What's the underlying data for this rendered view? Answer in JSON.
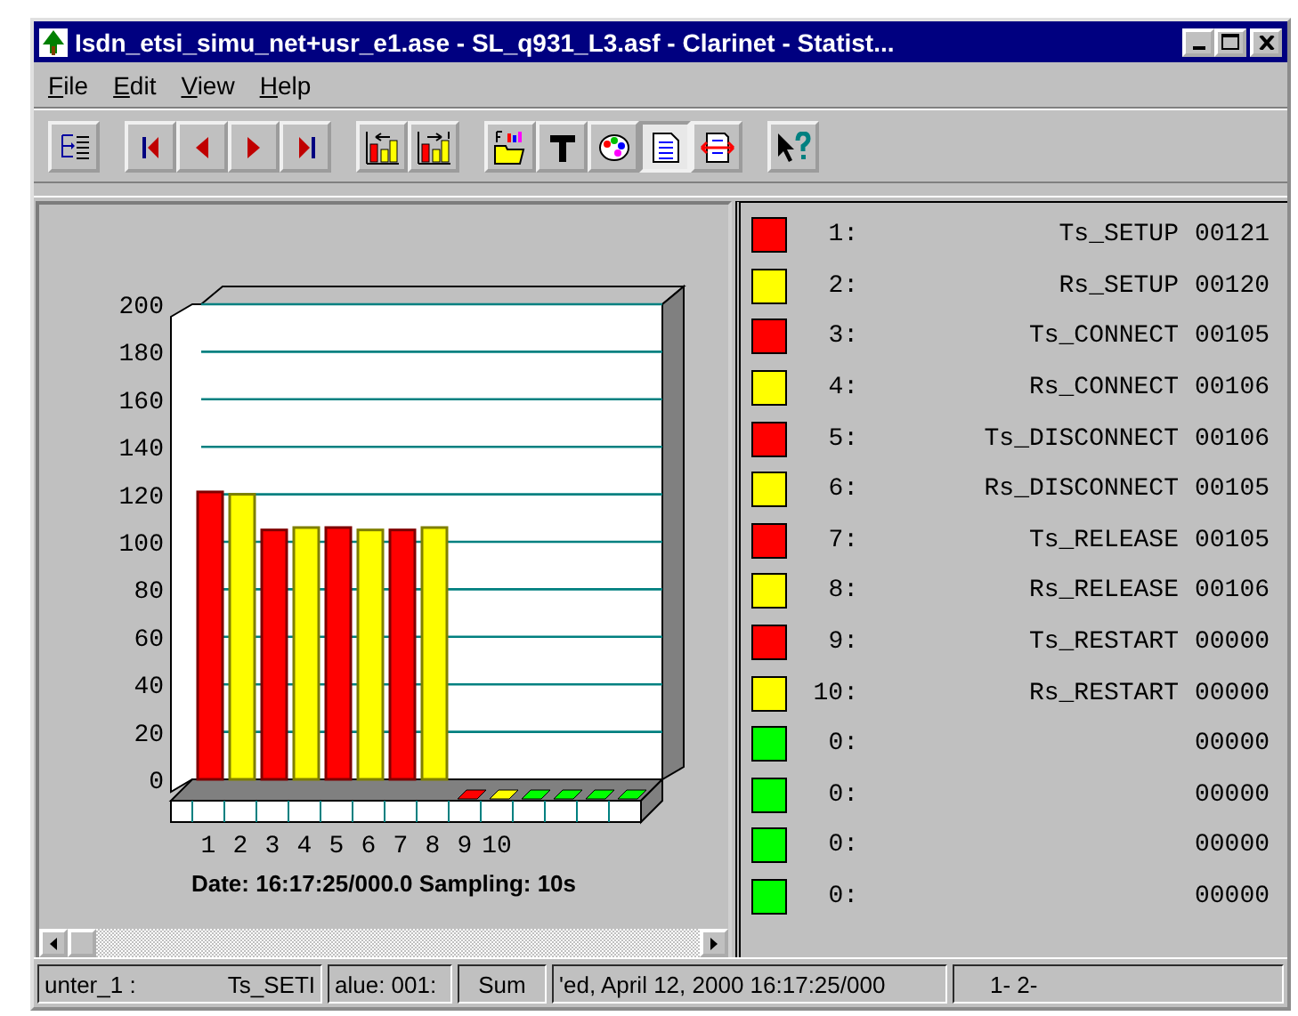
{
  "window": {
    "title": "Isdn_etsi_simu_net+usr_e1.ase - SL_q931_L3.asf - Clarinet - Statist..."
  },
  "menu": [
    "File",
    "Edit",
    "View",
    "Help"
  ],
  "toolbar": [
    [
      {
        "kind": "tree",
        "pressed": false
      }
    ],
    [
      {
        "kind": "first",
        "pressed": false
      },
      {
        "kind": "prev",
        "pressed": false
      },
      {
        "kind": "next",
        "pressed": false
      },
      {
        "kind": "last",
        "pressed": false
      }
    ],
    [
      {
        "kind": "bars-back",
        "pressed": false
      },
      {
        "kind": "bars-forward",
        "pressed": false
      }
    ],
    [
      {
        "kind": "open",
        "pressed": false
      },
      {
        "kind": "tool",
        "pressed": false
      },
      {
        "kind": "palette",
        "pressed": false
      },
      {
        "kind": "page",
        "pressed": true
      },
      {
        "kind": "exchange",
        "pressed": false
      }
    ],
    [
      {
        "kind": "help",
        "pressed": false
      }
    ]
  ],
  "chart": {
    "caption": "Date: 16:17:25/000.0  Sampling: 10s",
    "chart_data": {
      "type": "bar",
      "categories": [
        "1",
        "2",
        "3",
        "4",
        "5",
        "6",
        "7",
        "8",
        "9",
        "10"
      ],
      "values": [
        121,
        120,
        105,
        106,
        106,
        105,
        105,
        106,
        0,
        0
      ],
      "ylim": [
        0,
        200
      ],
      "grid": true,
      "yticks": [
        0,
        20,
        40,
        60,
        80,
        100,
        120,
        140,
        160,
        180,
        200
      ]
    }
  },
  "counters": [
    {
      "color": "#ff0000",
      "index": "1:",
      "name": "Ts_SETUP",
      "value": "00121"
    },
    {
      "color": "#ffff00",
      "index": "2:",
      "name": "Rs_SETUP",
      "value": "00120"
    },
    {
      "color": "#ff0000",
      "index": "3:",
      "name": "Ts_CONNECT",
      "value": "00105"
    },
    {
      "color": "#ffff00",
      "index": "4:",
      "name": "Rs_CONNECT",
      "value": "00106"
    },
    {
      "color": "#ff0000",
      "index": "5:",
      "name": "Ts_DISCONNECT",
      "value": "00106"
    },
    {
      "color": "#ffff00",
      "index": "6:",
      "name": "Rs_DISCONNECT",
      "value": "00105"
    },
    {
      "color": "#ff0000",
      "index": "7:",
      "name": "Ts_RELEASE",
      "value": "00105"
    },
    {
      "color": "#ffff00",
      "index": "8:",
      "name": "Rs_RELEASE",
      "value": "00106"
    },
    {
      "color": "#ff0000",
      "index": "9:",
      "name": "Ts_RESTART",
      "value": "00000"
    },
    {
      "color": "#ffff00",
      "index": "10:",
      "name": "Rs_RESTART",
      "value": "00000"
    },
    {
      "color": "#00ff00",
      "index": "0:",
      "value": "00000"
    },
    {
      "color": "#00ff00",
      "index": "0:",
      "value": "00000"
    },
    {
      "color": "#00ff00",
      "index": "0:",
      "value": "00000"
    },
    {
      "color": "#00ff00",
      "index": "0:",
      "value": "00000"
    }
  ],
  "status_bar": [
    {
      "texts": [
        "unter_1 :",
        "Ts_SETI"
      ]
    },
    {
      "texts": [
        "alue: 001:"
      ]
    },
    {
      "texts": [
        "Sum"
      ]
    },
    {
      "texts": [
        "'ed, April 12, 2000 16:17:25/000"
      ]
    },
    {
      "texts": [
        "1- 2-"
      ]
    }
  ]
}
